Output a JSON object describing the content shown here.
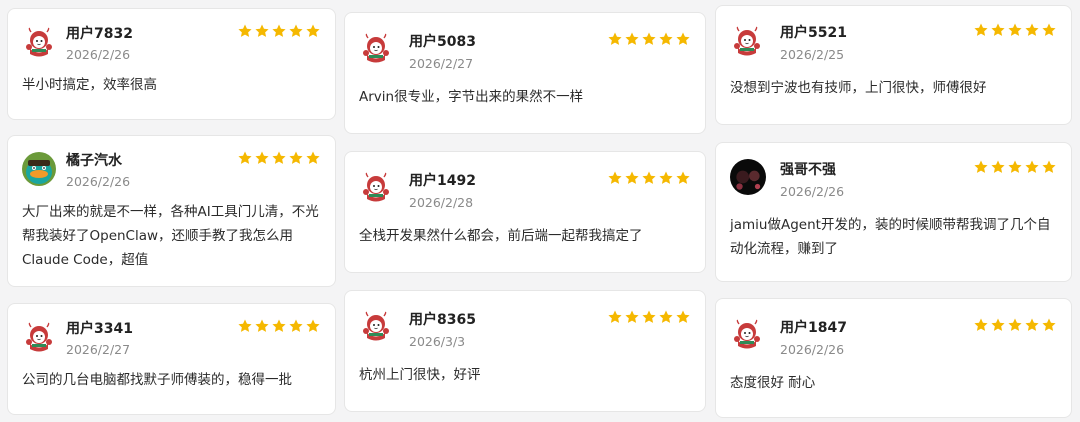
{
  "rating_color": "#f5b800",
  "reviews": [
    {
      "name": "用户7832",
      "date": "2026/2/26",
      "rating": 5,
      "text": "半小时搞定，效率很高",
      "avatar": "lobster-mascot-icon"
    },
    {
      "name": "橘子汽水",
      "date": "2026/2/26",
      "rating": 5,
      "text": "大厂出来的就是不一样，各种AI工具门儿清，不光帮我装好了OpenClaw，还顺手教了我怎么用Claude Code，超值",
      "avatar": "platypus-avatar-icon"
    },
    {
      "name": "用户3341",
      "date": "2026/2/27",
      "rating": 5,
      "text": "公司的几台电脑都找默子师傅装的，稳得一批",
      "avatar": "lobster-mascot-icon"
    },
    {
      "name": "用户5083",
      "date": "2026/2/27",
      "rating": 5,
      "text": "Arvin很专业，字节出来的果然不一样",
      "avatar": "lobster-mascot-icon"
    },
    {
      "name": "用户1492",
      "date": "2026/2/28",
      "rating": 5,
      "text": "全栈开发果然什么都会，前后端一起帮我搞定了",
      "avatar": "lobster-mascot-icon"
    },
    {
      "name": "用户8365",
      "date": "2026/3/3",
      "rating": 5,
      "text": "杭州上门很快，好评",
      "avatar": "lobster-mascot-icon"
    },
    {
      "name": "用户5521",
      "date": "2026/2/25",
      "rating": 5,
      "text": "没想到宁波也有技师，上门很快，师傅很好",
      "avatar": "lobster-mascot-icon"
    },
    {
      "name": "强哥不强",
      "date": "2026/2/26",
      "rating": 5,
      "text": "jamiu做Agent开发的，装的时候顺带帮我调了几个自动化流程，赚到了",
      "avatar": "dark-photo-avatar-icon"
    },
    {
      "name": "用户1847",
      "date": "2026/2/26",
      "rating": 5,
      "text": "态度很好 耐心",
      "avatar": "lobster-mascot-icon"
    }
  ]
}
